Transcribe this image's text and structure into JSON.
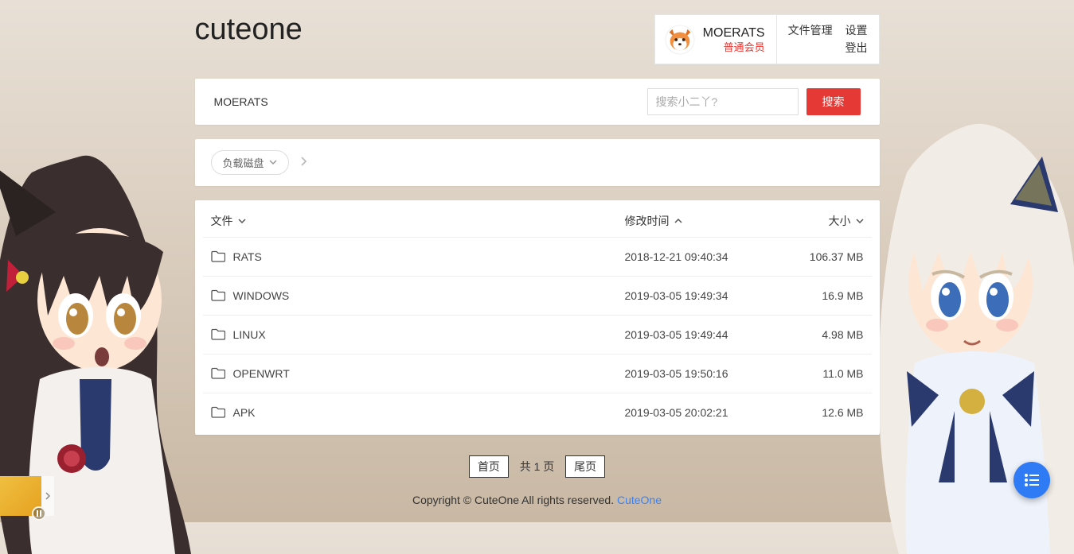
{
  "logo_text": "cuteone",
  "user": {
    "name": "MOERATS",
    "role": "普通会员"
  },
  "menu": {
    "file_mgmt": "文件管理",
    "settings": "设置",
    "logout": "登出"
  },
  "search_bar": {
    "disk_label": "MOERATS",
    "placeholder": "搜索小二丫?",
    "button": "搜索"
  },
  "breadcrumb": {
    "load_disk": "负载磁盘"
  },
  "list_header": {
    "name": "文件",
    "time": "修改时间",
    "size": "大小"
  },
  "files": [
    {
      "name": "RATS",
      "time": "2018-12-21 09:40:34",
      "size": "106.37 MB"
    },
    {
      "name": "WINDOWS",
      "time": "2019-03-05 19:49:34",
      "size": "16.9 MB"
    },
    {
      "name": "LINUX",
      "time": "2019-03-05 19:49:44",
      "size": "4.98 MB"
    },
    {
      "name": "OPENWRT",
      "time": "2019-03-05 19:50:16",
      "size": "11.0 MB"
    },
    {
      "name": "APK",
      "time": "2019-03-05 20:02:21",
      "size": "12.6 MB"
    }
  ],
  "pager": {
    "first": "首页",
    "total": "共 1 页",
    "last": "尾页"
  },
  "footer": {
    "text": "Copyright © CuteOne All rights reserved. ",
    "link": "CuteOne"
  }
}
